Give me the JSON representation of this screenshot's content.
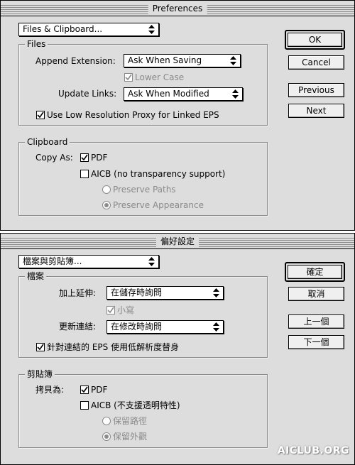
{
  "english": {
    "window_title": "Preferences",
    "section_popup": "Files & Clipboard...",
    "files_group": {
      "title": "Files",
      "append_extension_label": "Append Extension:",
      "append_extension_value": "Ask When Saving",
      "lower_case_label": "Lower Case",
      "update_links_label": "Update Links:",
      "update_links_value": "Ask When Modified",
      "low_res_proxy_label": "Use Low Resolution Proxy for Linked EPS"
    },
    "clipboard_group": {
      "title": "Clipboard",
      "copy_as_label": "Copy As:",
      "pdf_label": "PDF",
      "aicb_label": "AICB (no transparency support)",
      "preserve_paths_label": "Preserve Paths",
      "preserve_appearance_label": "Preserve Appearance"
    },
    "buttons": {
      "ok": "OK",
      "cancel": "Cancel",
      "previous": "Previous",
      "next": "Next"
    }
  },
  "chinese": {
    "window_title": "偏好設定",
    "section_popup": "檔案與剪貼簿...",
    "files_group": {
      "title": "檔案",
      "append_extension_label": "加上延伸:",
      "append_extension_value": "在儲存時詢問",
      "lower_case_label": "小寫",
      "update_links_label": "更新連結:",
      "update_links_value": "在修改時詢問",
      "low_res_proxy_label": "針對連結的 EPS 使用低解析度替身"
    },
    "clipboard_group": {
      "title": "剪貼簿",
      "copy_as_label": "拷貝為:",
      "pdf_label": "PDF",
      "aicb_label": "AICB (不支援透明特性)",
      "preserve_paths_label": "保留路徑",
      "preserve_appearance_label": "保留外觀"
    },
    "buttons": {
      "ok": "確定",
      "cancel": "取消",
      "previous": "上一個",
      "next": "下一個"
    }
  },
  "watermark": "AICLUB.ORG",
  "colors": {
    "dialog_bg": "#dddddd",
    "disabled_text": "#8a8a8a"
  }
}
